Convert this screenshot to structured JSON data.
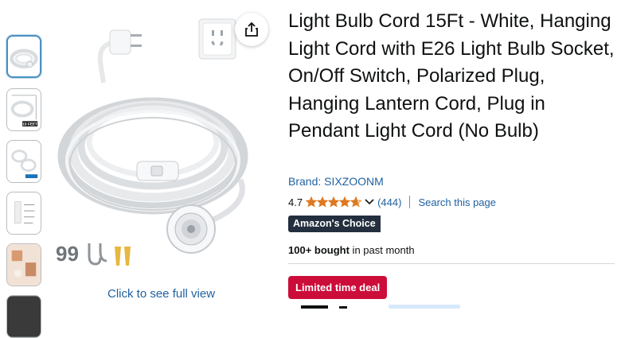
{
  "gallery": {
    "thumbnails": [
      {
        "label": "",
        "active": true
      },
      {
        "label": "15 FEET",
        "active": false
      },
      {
        "label": "",
        "active": false
      },
      {
        "label": "",
        "active": false
      },
      {
        "label": "",
        "active": false
      },
      {
        "label": "",
        "active": false
      }
    ],
    "see_full_view": "Click to see full view",
    "share_icon": "share-icon"
  },
  "product": {
    "title": "Light Bulb Cord 15Ft - White, Hanging Light Cord with E26 Light Bulb Socket, On/Off Switch, Polarized Plug, Hanging Lantern Cord, Plug in Pendant Light Cord (No Bulb)",
    "brand": "Brand: SIXZOONM",
    "rating": "4.7",
    "rating_value": 4.7,
    "review_count": "(444)",
    "search_page": "Search this page",
    "badge": "Amazon's Choice",
    "bought_bold": "100+ bought",
    "bought_rest": " in past month",
    "deal": "Limited time deal"
  },
  "colors": {
    "link": "#2162a1",
    "star": "#de7921",
    "choice_bg": "#232f3e",
    "deal_bg": "#cc0c39"
  }
}
